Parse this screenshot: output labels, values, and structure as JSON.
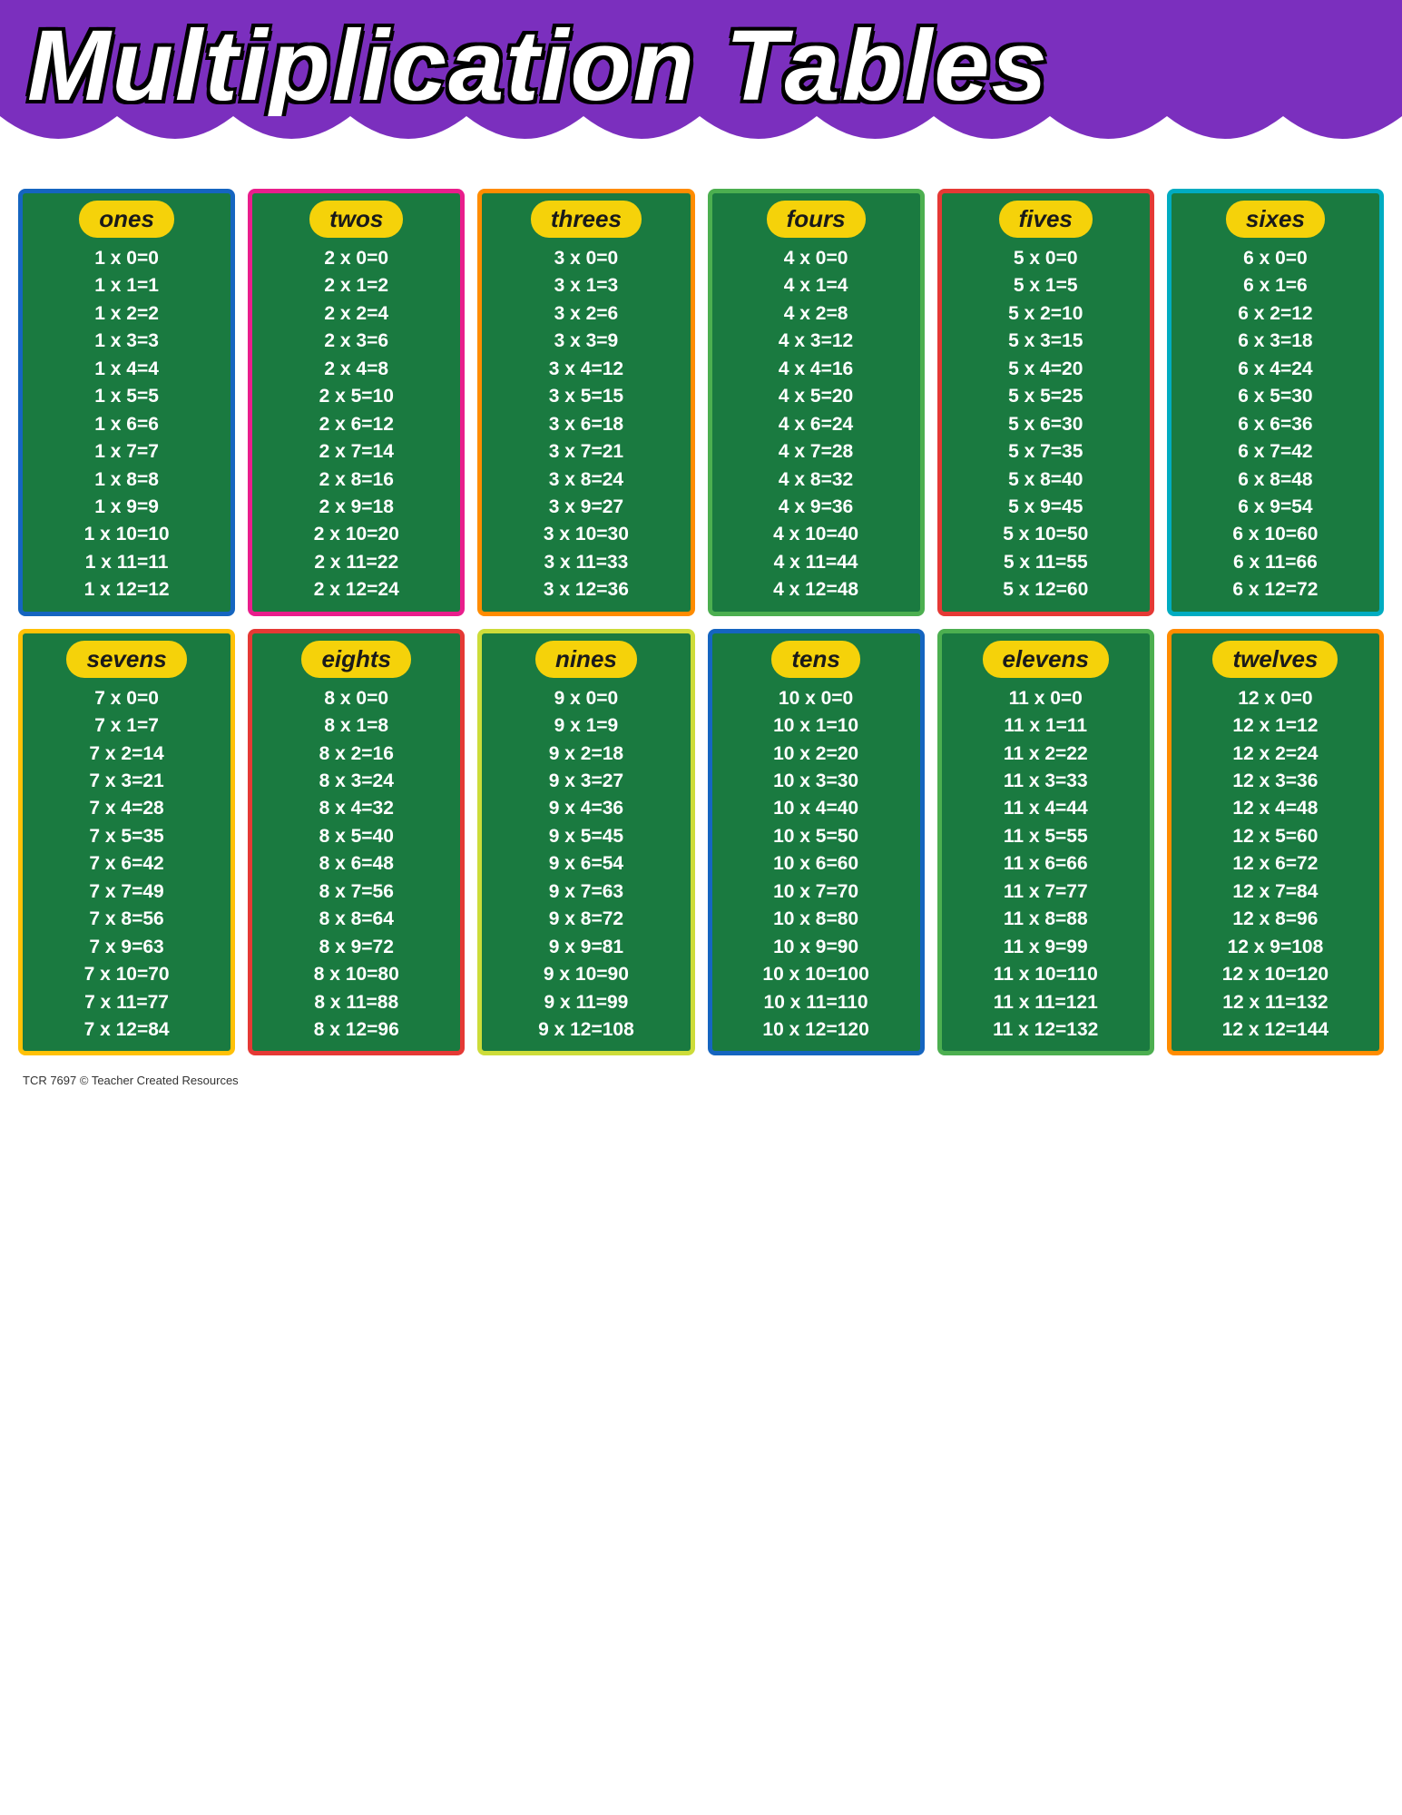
{
  "header": {
    "title": "Multiplication Tables",
    "bg_color": "#7b2fbe"
  },
  "footer": {
    "text": "TCR 7697  © Teacher Created Resources"
  },
  "tables": [
    {
      "id": "ones",
      "label": "ones",
      "border_class": "blue",
      "rows": [
        "1 x 0=0",
        "1 x 1=1",
        "1 x 2=2",
        "1 x 3=3",
        "1 x 4=4",
        "1 x 5=5",
        "1 x 6=6",
        "1 x 7=7",
        "1 x 8=8",
        "1 x 9=9",
        "1 x 10=10",
        "1 x 11=11",
        "1 x 12=12"
      ]
    },
    {
      "id": "twos",
      "label": "twos",
      "border_class": "pink",
      "rows": [
        "2 x 0=0",
        "2 x 1=2",
        "2 x 2=4",
        "2 x 3=6",
        "2 x 4=8",
        "2 x 5=10",
        "2 x 6=12",
        "2 x 7=14",
        "2 x 8=16",
        "2 x 9=18",
        "2 x 10=20",
        "2 x 11=22",
        "2 x 12=24"
      ]
    },
    {
      "id": "threes",
      "label": "threes",
      "border_class": "orange",
      "rows": [
        "3 x 0=0",
        "3 x 1=3",
        "3 x 2=6",
        "3 x 3=9",
        "3 x 4=12",
        "3 x 5=15",
        "3 x 6=18",
        "3 x 7=21",
        "3 x 8=24",
        "3 x 9=27",
        "3 x 10=30",
        "3 x 11=33",
        "3 x 12=36"
      ]
    },
    {
      "id": "fours",
      "label": "fours",
      "border_class": "green",
      "rows": [
        "4 x 0=0",
        "4 x 1=4",
        "4 x 2=8",
        "4 x 3=12",
        "4 x 4=16",
        "4 x 5=20",
        "4 x 6=24",
        "4 x 7=28",
        "4 x 8=32",
        "4 x 9=36",
        "4 x 10=40",
        "4 x 11=44",
        "4 x 12=48"
      ]
    },
    {
      "id": "fives",
      "label": "fives",
      "border_class": "red",
      "rows": [
        "5 x 0=0",
        "5 x 1=5",
        "5 x 2=10",
        "5 x 3=15",
        "5 x 4=20",
        "5 x 5=25",
        "5 x 6=30",
        "5 x 7=35",
        "5 x 8=40",
        "5 x 9=45",
        "5 x 10=50",
        "5 x 11=55",
        "5 x 12=60"
      ]
    },
    {
      "id": "sixes",
      "label": "sixes",
      "border_class": "teal",
      "rows": [
        "6 x 0=0",
        "6 x 1=6",
        "6 x 2=12",
        "6 x 3=18",
        "6 x 4=24",
        "6 x 5=30",
        "6 x 6=36",
        "6 x 7=42",
        "6 x 8=48",
        "6 x 9=54",
        "6 x 10=60",
        "6 x 11=66",
        "6 x 12=72"
      ]
    },
    {
      "id": "sevens",
      "label": "sevens",
      "border_class": "yellow-border",
      "rows": [
        "7 x 0=0",
        "7 x 1=7",
        "7 x 2=14",
        "7 x 3=21",
        "7 x 4=28",
        "7 x 5=35",
        "7 x 6=42",
        "7 x 7=49",
        "7 x 8=56",
        "7 x 9=63",
        "7 x 10=70",
        "7 x 11=77",
        "7 x 12=84"
      ]
    },
    {
      "id": "eights",
      "label": "eights",
      "border_class": "red",
      "rows": [
        "8 x 0=0",
        "8 x 1=8",
        "8 x 2=16",
        "8 x 3=24",
        "8 x 4=32",
        "8 x 5=40",
        "8 x 6=48",
        "8 x 7=56",
        "8 x 8=64",
        "8 x 9=72",
        "8 x 10=80",
        "8 x 11=88",
        "8 x 12=96"
      ]
    },
    {
      "id": "nines",
      "label": "nines",
      "border_class": "lime",
      "rows": [
        "9 x 0=0",
        "9 x 1=9",
        "9 x 2=18",
        "9 x 3=27",
        "9 x 4=36",
        "9 x 5=45",
        "9 x 6=54",
        "9 x 7=63",
        "9 x 8=72",
        "9 x 9=81",
        "9 x 10=90",
        "9 x 11=99",
        "9 x 12=108"
      ]
    },
    {
      "id": "tens",
      "label": "tens",
      "border_class": "blue",
      "rows": [
        "10 x 0=0",
        "10 x 1=10",
        "10 x 2=20",
        "10 x 3=30",
        "10 x 4=40",
        "10 x 5=50",
        "10 x 6=60",
        "10 x 7=70",
        "10 x 8=80",
        "10 x 9=90",
        "10 x 10=100",
        "10 x 11=110",
        "10 x 12=120"
      ]
    },
    {
      "id": "elevens",
      "label": "elevens",
      "border_class": "green",
      "rows": [
        "11 x 0=0",
        "11 x 1=11",
        "11 x 2=22",
        "11 x 3=33",
        "11 x 4=44",
        "11 x 5=55",
        "11 x 6=66",
        "11 x 7=77",
        "11 x 8=88",
        "11 x 9=99",
        "11 x 10=110",
        "11 x 11=121",
        "11 x 12=132"
      ]
    },
    {
      "id": "twelves",
      "label": "twelves",
      "border_class": "orange",
      "rows": [
        "12 x 0=0",
        "12 x 1=12",
        "12 x 2=24",
        "12 x 3=36",
        "12 x 4=48",
        "12 x 5=60",
        "12 x 6=72",
        "12 x 7=84",
        "12 x 8=96",
        "12 x 9=108",
        "12 x 10=120",
        "12 x 11=132",
        "12 x 12=144"
      ]
    }
  ]
}
